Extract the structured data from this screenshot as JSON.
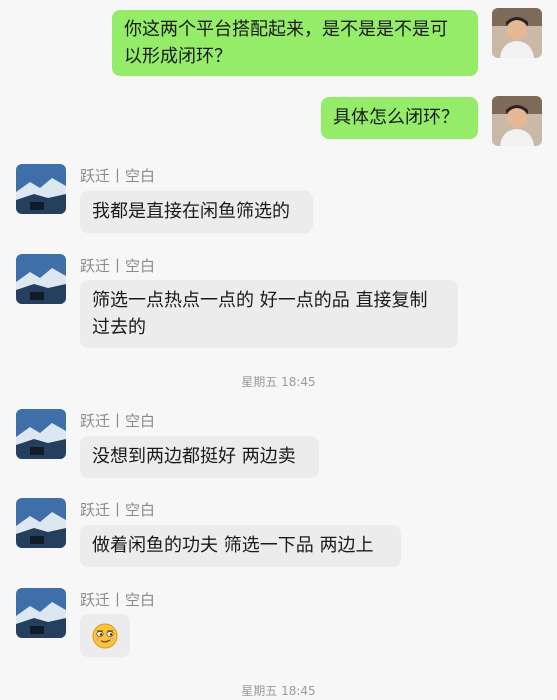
{
  "messages": [
    {
      "sender": "",
      "text": "你这两个平台搭配起来，是不是是不是可以形成闭环？",
      "line1": "你这两个平台搭配起来，是不是是不是可",
      "line2": "以形成闭环？",
      "direction": "out"
    },
    {
      "sender": "",
      "text": "具体怎么闭环？",
      "direction": "out"
    },
    {
      "sender": "跃迁丨空白",
      "text": "我都是直接在闲鱼筛选的",
      "direction": "in"
    },
    {
      "sender": "跃迁丨空白",
      "line1": "筛选一点热点一点的 好一点的品 直接复制",
      "line2": "过去的",
      "direction": "in"
    },
    {
      "sender": "跃迁丨空白",
      "text": "没想到两边都挺好 两边卖",
      "direction": "in"
    },
    {
      "sender": "跃迁丨空白",
      "text": "做着闲鱼的功夫 筛选一下品 两边上",
      "direction": "in"
    },
    {
      "sender": "跃迁丨空白",
      "emoji": "smirk-emoji",
      "direction": "in"
    }
  ],
  "timestamps": [
    "星期五 18:45",
    "星期五 18:45"
  ],
  "colors": {
    "outgoing_bubble": "#95ec69",
    "incoming_bubble": "#ececec",
    "background": "#f7f7f7"
  }
}
